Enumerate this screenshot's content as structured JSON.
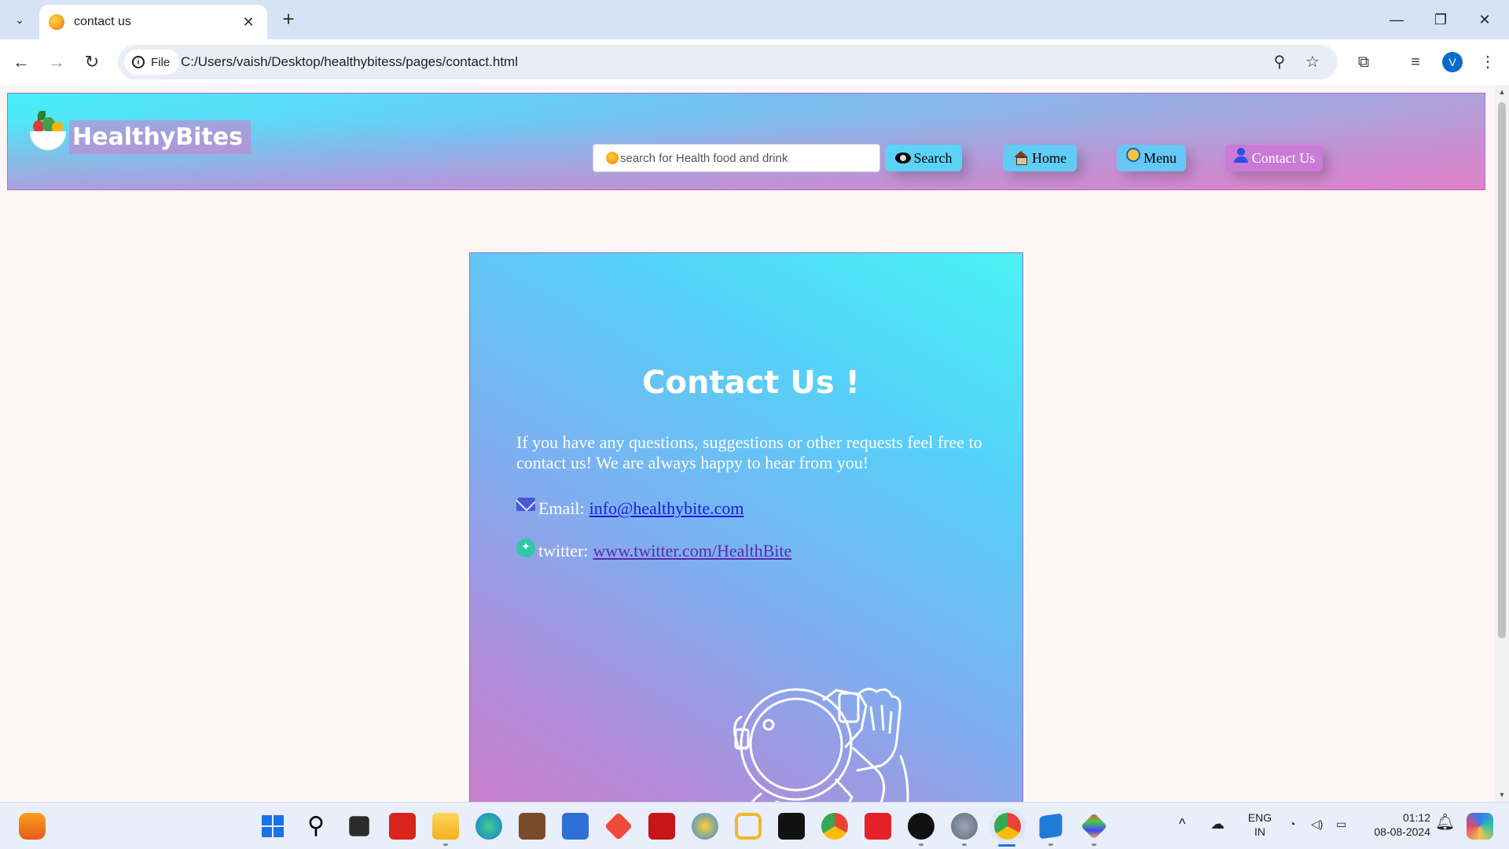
{
  "browser": {
    "tab_title": "contact us",
    "site_info_label": "File",
    "url": "C:/Users/vaish/Desktop/healthybitess/pages/contact.html",
    "profile_initial": "V"
  },
  "site": {
    "brand": "HealthyBites",
    "search_placeholder": "search for Health food and drink",
    "nav": {
      "search_label": "Search",
      "home_label": "Home",
      "menu_label": "Menu",
      "contact_label": "Contact Us"
    }
  },
  "contact": {
    "title": "Contact Us !",
    "intro": "If you have any questions, suggestions or other requests feel free to contact us! We are always happy to hear from you!",
    "email_label": "Email:",
    "email_value": "info@healthybite.com",
    "twitter_label": "twitter:",
    "twitter_value": "www.twitter.com/HealthBite"
  },
  "taskbar": {
    "lang_top": "ENG",
    "lang_bottom": "IN",
    "time": "01:12",
    "date": "08-08-2024"
  },
  "colors": {
    "header_gradient_start": "#46f0f7",
    "header_gradient_end": "#d48acb",
    "card_gradient_top": "#4af3f3",
    "card_gradient_bottom": "#d07cc8",
    "contact_button": "#c97bd6",
    "link": "#1a1ae0"
  }
}
